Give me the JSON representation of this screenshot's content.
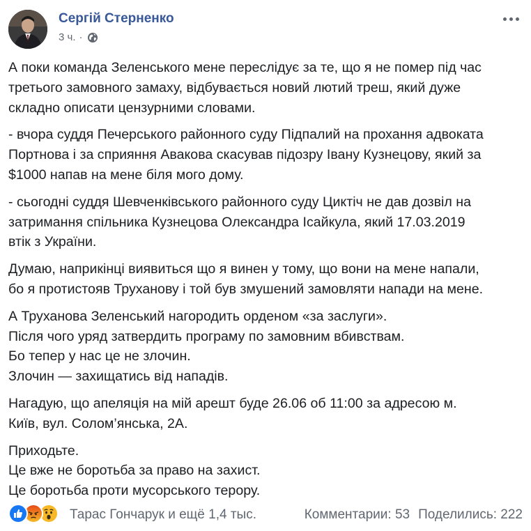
{
  "author": {
    "name": "Сергій Стерненко",
    "time": "3 ч.",
    "separator": "·",
    "privacy_icon": "globe-icon"
  },
  "post": {
    "paragraphs": [
      [
        "А поки команда Зеленського мене переслідує за те, що я не помер під час",
        "третього замовного замаху, відбувається новий лютий треш, який дуже",
        "складно описати цензурними словами."
      ],
      [
        "- вчора суддя Печерського районного суду Підпалий на прохання адвоката",
        "Портнова і за сприяння Авакова скасував підозру Івану Кузнецову, який за",
        "$1000 напав на мене біля мого дому."
      ],
      [
        "- сьогодні суддя Шевченківського районного суду Циктіч не дав дозвіл на",
        "затримання спільника Кузнецова Олександра Ісайкула, який 17.03.2019",
        "втік з України."
      ],
      [
        "Думаю, наприкінці виявиться що я винен у тому, що вони на мене напали,",
        "бо я протистояв Труханову і той був змушений замовляти напади на мене."
      ],
      [
        "А Труханова Зеленський нагородить орденом «за заслуги».",
        "Після чого уряд затвердить програму по замовним вбивствам.",
        "Бо тепер у нас це не злочин.",
        "Злочин — захищатись від нападів."
      ],
      [
        "Нагадую, що апеляція на мій арешт буде 26.06 об 11:00 за адресою м.",
        "Київ, вул. Солом’янська, 2А."
      ],
      [
        "Приходьте.",
        "Це вже не боротьба за право на захист.",
        "Це боротьба проти мусорського терору."
      ]
    ]
  },
  "footer": {
    "reactions": [
      "like-icon",
      "angry-icon",
      "wow-icon"
    ],
    "reactors_text": "Тарас Гончарук и ещё 1,4 тыс.",
    "comments": "Комментарии: 53",
    "shares": "Поделились: 222"
  },
  "colors": {
    "name": "#385898",
    "meta": "#606770",
    "text": "#1c1e21",
    "like": "#1877f2",
    "angry": "#e9710f",
    "wow": "#f7b928"
  }
}
